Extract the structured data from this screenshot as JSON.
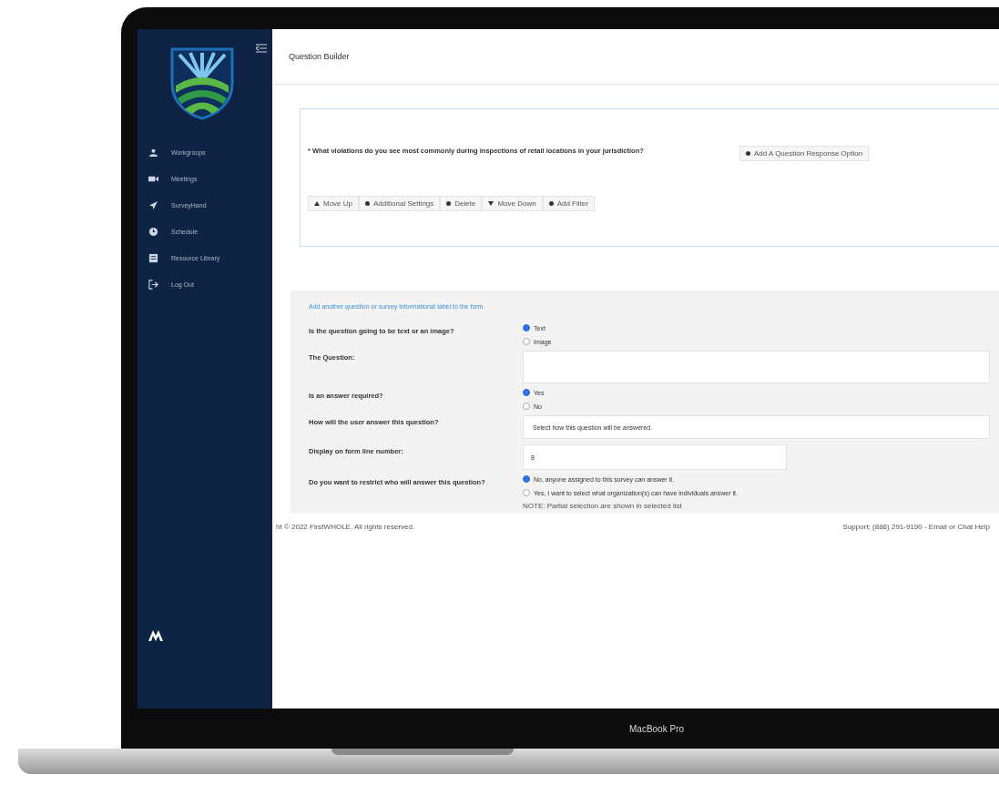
{
  "sidebar": {
    "items": [
      {
        "label": "Workgroups"
      },
      {
        "label": "Meetings"
      },
      {
        "label": "SurveyHand"
      },
      {
        "label": "Schedule"
      },
      {
        "label": "Resource Library"
      },
      {
        "label": "Log Out"
      }
    ]
  },
  "page": {
    "title": "Question Builder"
  },
  "question_card": {
    "question": "* What violations do you see most commonly during inspections of retail locations in your jurisdiction?",
    "add_option_button": "Add A Question Response Option",
    "actions": [
      {
        "label": "Move Up"
      },
      {
        "label": "Additional Settings"
      },
      {
        "label": "Delete"
      },
      {
        "label": "Move Down"
      },
      {
        "label": "Add Filter"
      }
    ]
  },
  "form": {
    "link": "Add another question or survey informational label to the form.",
    "rows": [
      {
        "kind": "radio",
        "label": "Is the question going to be text or an image?",
        "options": [
          {
            "label": "Text",
            "selected": true
          },
          {
            "label": "Image",
            "selected": false
          }
        ]
      },
      {
        "kind": "textarea",
        "label": "The Question:"
      },
      {
        "kind": "radio",
        "label": "Is an answer required?",
        "options": [
          {
            "label": "Yes",
            "selected": true
          },
          {
            "label": "No",
            "selected": false
          }
        ]
      },
      {
        "kind": "select",
        "label": "How will the user answer this question?",
        "value": "Select how this question will be answered."
      },
      {
        "kind": "input",
        "label": "Display on form line number:",
        "value": "8"
      },
      {
        "kind": "radio",
        "label": "Do you want to restrict who will answer this question?",
        "options": [
          {
            "label": "No, anyone assigned to this survey can answer it.",
            "selected": true
          },
          {
            "label": "Yes, I want to select what organization(s) can have individuals answer it.",
            "selected": false
          }
        ]
      }
    ],
    "note": "NOTE: Partial selection are shown in selected list"
  },
  "footer": {
    "copyright": "ht © 2022 FirstWHOLE. All rights reserved.",
    "support": "Support: (888) 291-9190 - Email or Chat Help"
  },
  "device": {
    "label": "MacBook Pro"
  }
}
